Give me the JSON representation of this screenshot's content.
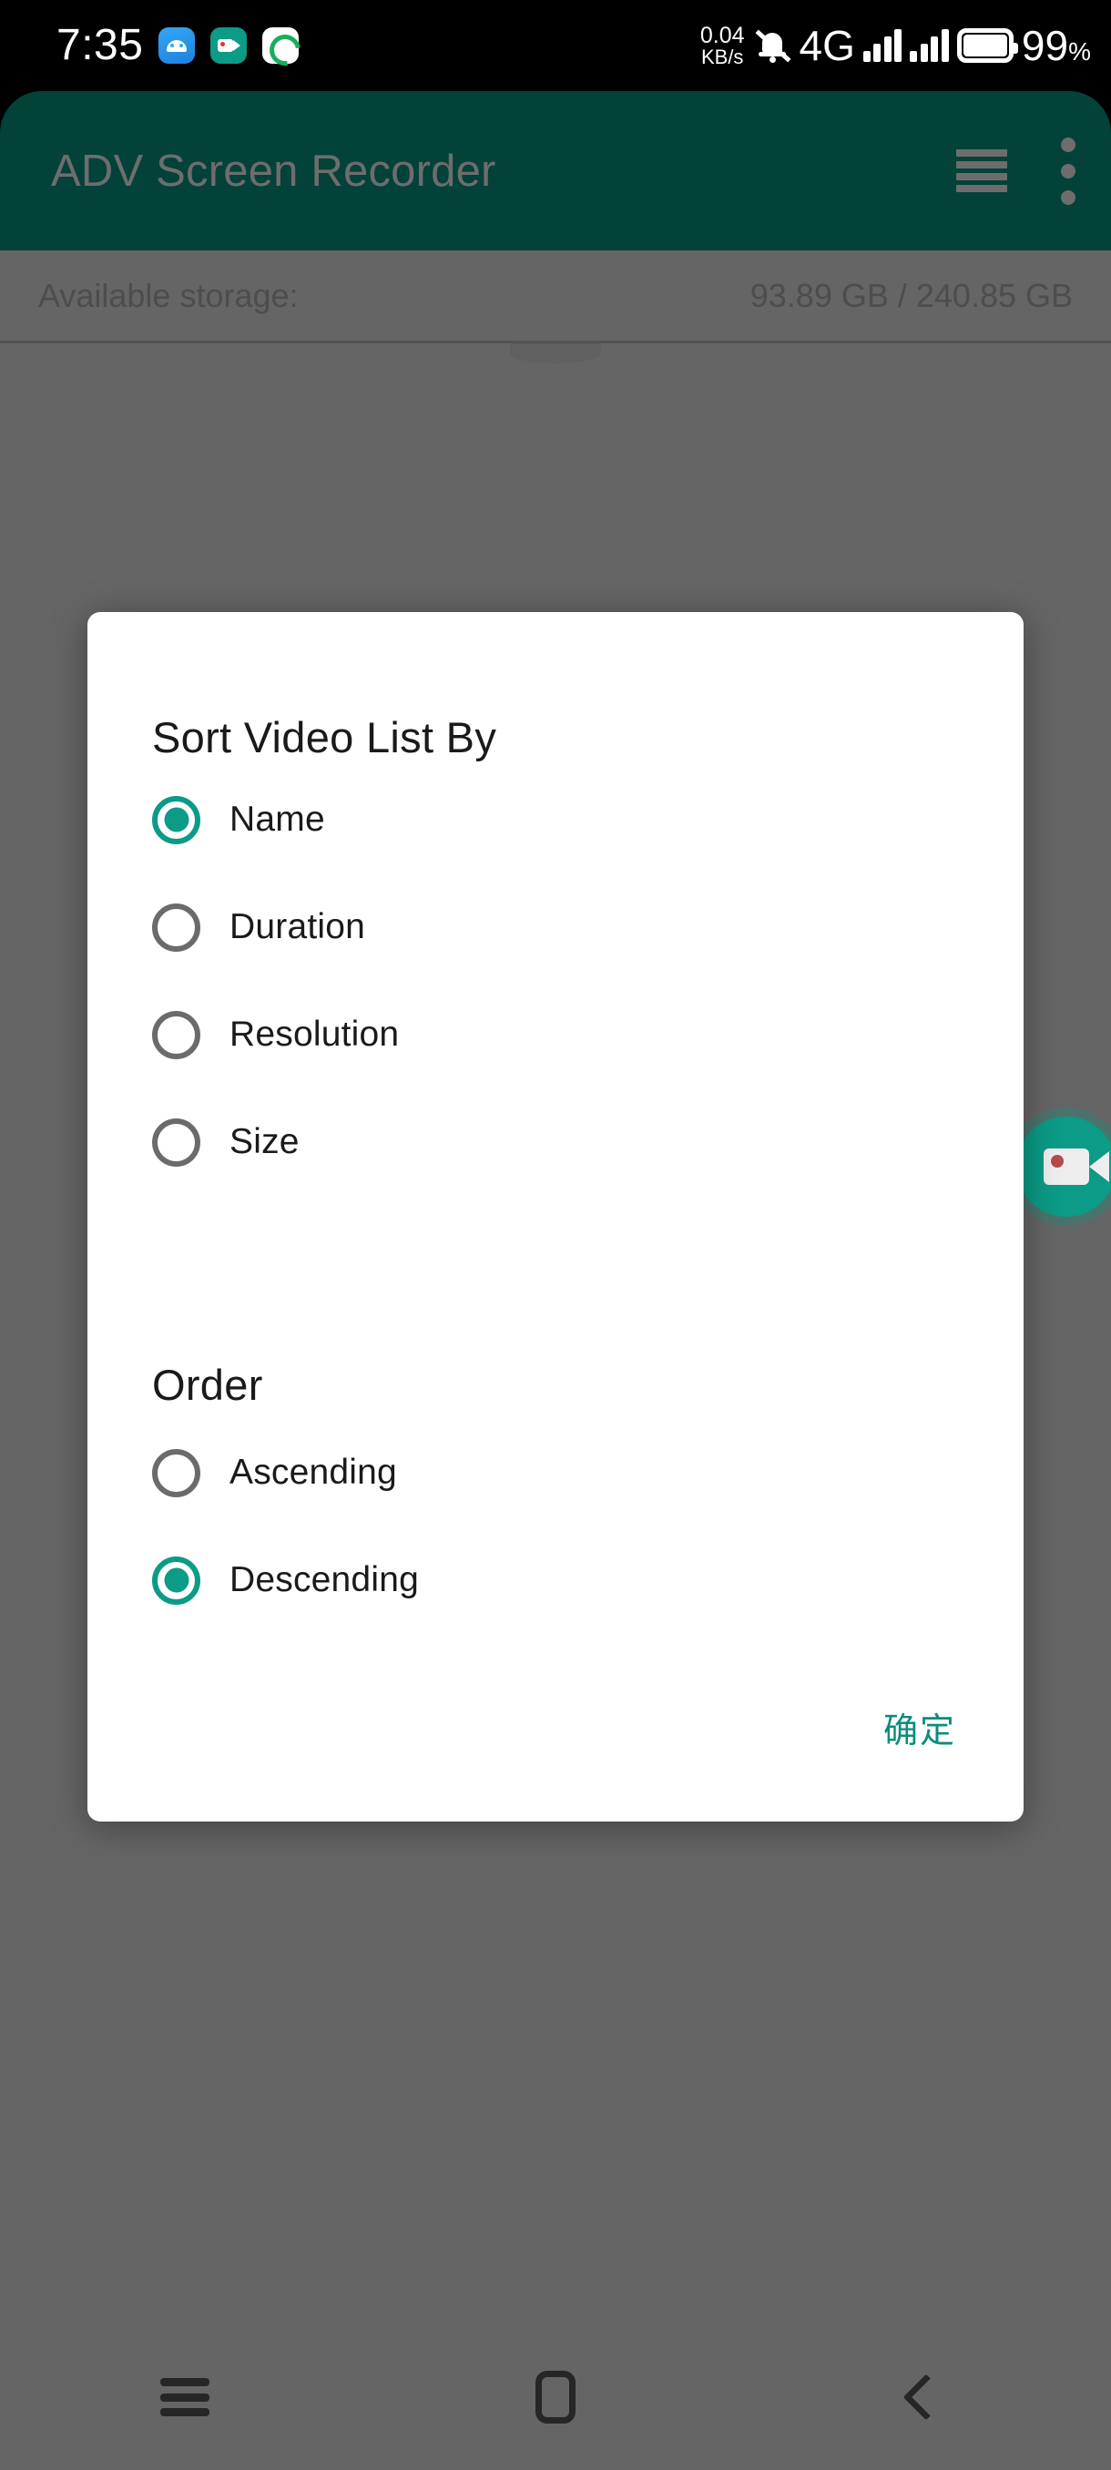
{
  "status_bar": {
    "clock": "7:35",
    "icons": [
      "android-icon",
      "screen-recorder-icon",
      "sync-icon"
    ],
    "network_speed_value": "0.04",
    "network_speed_unit": "KB/s",
    "mute_icon": "bell-muted-icon",
    "network_type": "4G",
    "signal_bars_1": "signal-bars-icon",
    "signal_bars_2": "signal-bars-icon",
    "battery_icon": "battery-full-icon",
    "battery_level": "99",
    "battery_unit": "%"
  },
  "app_bar": {
    "title": "ADV Screen Recorder",
    "sort_icon": "sort-lines-icon",
    "overflow_icon": "more-vertical-icon",
    "background_color": "#034238",
    "title_color": "#6d6d6d"
  },
  "storage": {
    "label": "Available storage:",
    "value": "93.89 GB / 240.85 GB"
  },
  "fab": {
    "icon": "video-camera-record-icon",
    "color": "#0b9b86"
  },
  "dialog": {
    "title": "Sort Video List By",
    "sort_options": [
      {
        "label": "Name",
        "selected": true
      },
      {
        "label": "Duration",
        "selected": false
      },
      {
        "label": "Resolution",
        "selected": false
      },
      {
        "label": "Size",
        "selected": false
      }
    ],
    "order_heading": "Order",
    "order_options": [
      {
        "label": "Ascending",
        "selected": false
      },
      {
        "label": "Descending",
        "selected": true
      }
    ],
    "confirm_label": "确定",
    "accent_color": "#0b9b86",
    "confirm_color": "#0d8c7c"
  },
  "nav_bar": {
    "recents": "recents-icon",
    "home": "home-icon",
    "back": "back-icon"
  }
}
